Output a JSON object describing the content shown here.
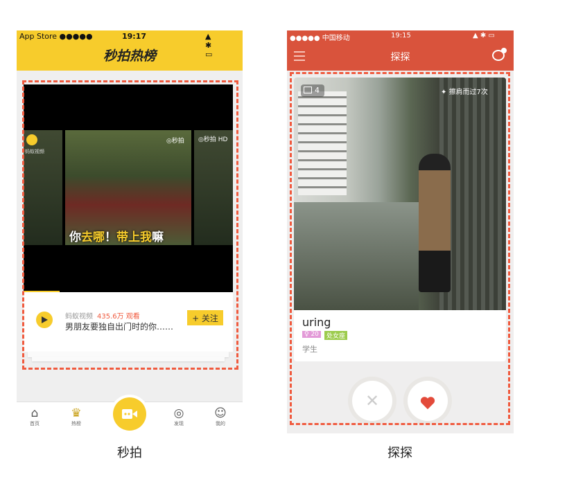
{
  "panels": [
    {
      "caption": "秒拍",
      "status": {
        "carrier": "App Store ●●●●● ",
        "time": "19:17",
        "right": "▲ ✱ ▭"
      },
      "title": "秒拍热榜",
      "video": {
        "subtitle_white": "你",
        "subtitle_yellow": "去哪",
        "subtitle_white2": "！",
        "subtitle_yellow2": "带上我",
        "subtitle_white3": "嘛",
        "watermark": "◎秒拍",
        "watermark_side": "◎秒拍 HD",
        "source_badge": "蚂蚁视频",
        "progress": 0.17
      },
      "card": {
        "author": "蚂蚁视频",
        "views": "435.6万 观看",
        "description": "男朋友要独自出门时的你……",
        "follow_label": "+ 关注"
      },
      "tabbar": [
        {
          "icon": "home-icon",
          "label": "首页"
        },
        {
          "icon": "trophy-icon",
          "label": "热榜"
        },
        {
          "icon": "camera-icon",
          "label": ""
        },
        {
          "icon": "discover-icon",
          "label": "发现"
        },
        {
          "icon": "profile-icon",
          "label": "我的"
        }
      ],
      "accent": "#f7cc2c"
    },
    {
      "caption": "探探",
      "status": {
        "carrier": "●●●●● 中国移动",
        "time": "19:15",
        "right": "▲ ✱ ▭"
      },
      "title": "探探",
      "photo": {
        "count": "4",
        "passed": "擦肩而过7次"
      },
      "profile": {
        "name": "uring",
        "age": "♀ 20",
        "sign": "处女座",
        "job": "学生"
      },
      "accent": "#d9533c"
    }
  ]
}
